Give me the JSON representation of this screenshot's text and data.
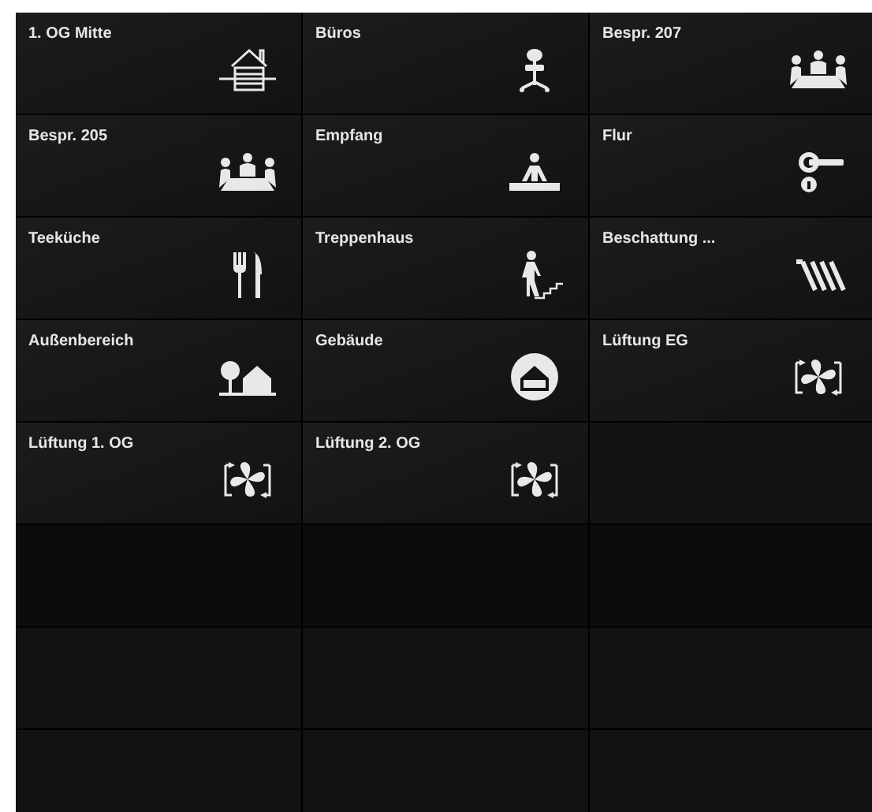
{
  "tiles": [
    {
      "label": "1. OG Mitte"
    },
    {
      "label": "Büros"
    },
    {
      "label": "Bespr. 207"
    },
    {
      "label": "Bespr. 205"
    },
    {
      "label": "Empfang"
    },
    {
      "label": "Flur"
    },
    {
      "label": "Teeküche"
    },
    {
      "label": "Treppenhaus"
    },
    {
      "label": "Beschattung ..."
    },
    {
      "label": "Außenbereich"
    },
    {
      "label": "Gebäude"
    },
    {
      "label": "Lüftung EG"
    },
    {
      "label": "Lüftung 1. OG"
    },
    {
      "label": "Lüftung 2. OG"
    }
  ]
}
